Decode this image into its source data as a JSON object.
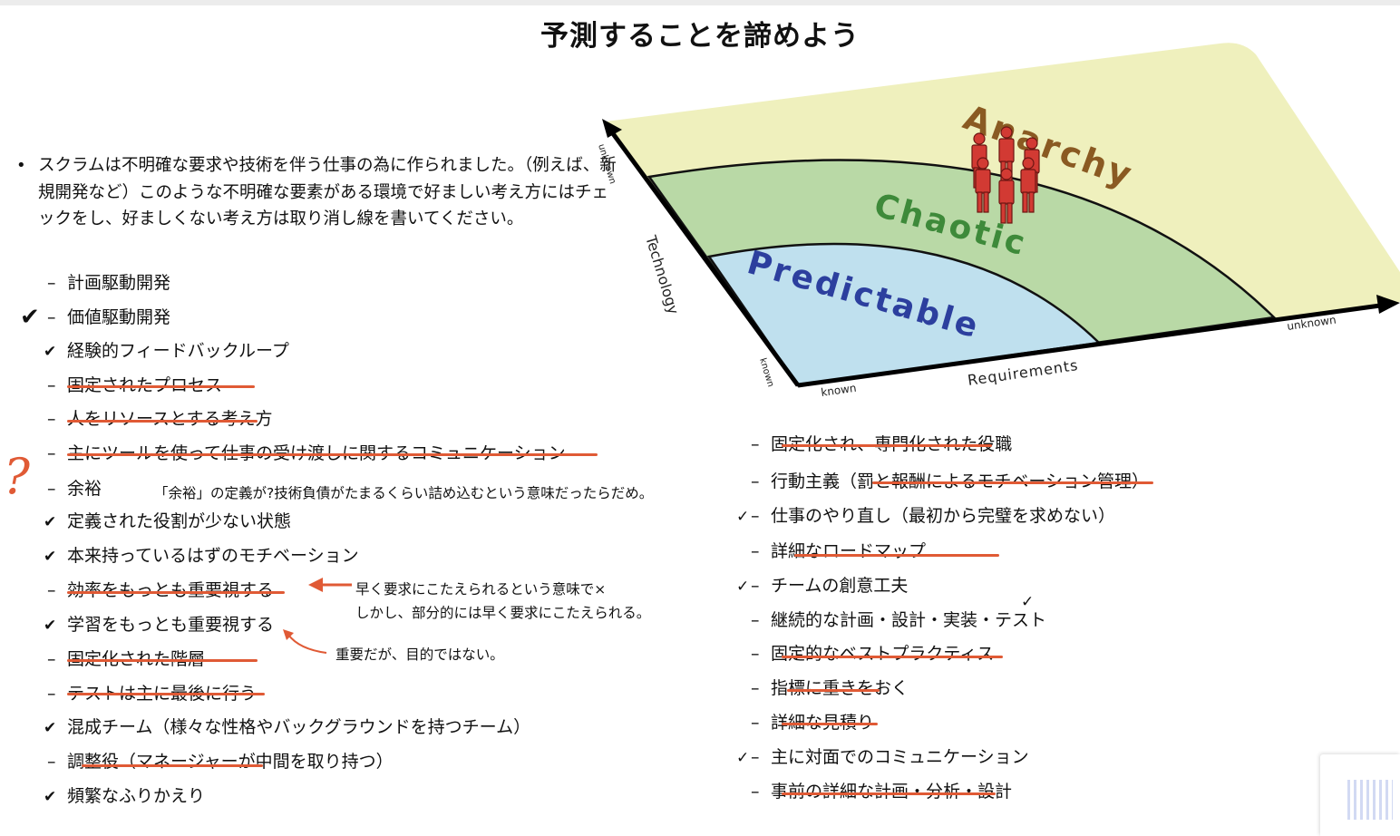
{
  "title": "予測することを諦めよう",
  "intro": "スクラムは不明確な要求や技術を伴う仕事の為に作られました。（例えば、新規開発など）このような不明確な要素がある環境で好ましい考え方にはチェックをし、好ましくない考え方は取り消し線を書いてください。",
  "bullet_symbol": "•",
  "diagram": {
    "anarchy": "Anarchy",
    "chaotic": "Chaotic",
    "predictable": "Predictable",
    "technology": "Technology",
    "requirements": "Requirements",
    "tech_unknown": "unknown",
    "tech_known": "known",
    "req_known": "known",
    "req_unknown": "unknown",
    "colors": {
      "anarchy": "#eff0bd",
      "chaotic": "#b9d9a6",
      "predictable": "#bfe0ee",
      "anarchy_text": "#8a5a22",
      "chaotic_text": "#3e8a3a",
      "predictable_text": "#2c3f9e",
      "people": "#d23a33"
    }
  },
  "left_items": [
    {
      "text": "計画駆動開発",
      "mark": ""
    },
    {
      "text": "価値駆動開発",
      "mark": "check-large"
    },
    {
      "text": "経験的フィードバックループ",
      "mark": "check"
    },
    {
      "text": "固定されたプロセス",
      "mark": "strike"
    },
    {
      "text": "人をリソースとする考え方",
      "mark": "strike"
    },
    {
      "text": "主にツールを使って仕事の受け渡しに関するコミュニケーション",
      "mark": "strike"
    },
    {
      "text": "余裕",
      "mark": "question"
    },
    {
      "text": "定義された役割が少ない状態",
      "mark": "check"
    },
    {
      "text": "本来持っているはずのモチベーション",
      "mark": "check"
    },
    {
      "text": "効率をもっとも重要視する",
      "mark": "strike"
    },
    {
      "text": "学習をもっとも重要視する",
      "mark": "check"
    },
    {
      "text": "固定化された階層",
      "mark": "strike"
    },
    {
      "text": "テストは主に最後に行う",
      "mark": "strike"
    },
    {
      "text": "混成チーム（様々な性格やバックグラウンドを持つチーム）",
      "mark": "check"
    },
    {
      "text": "調整役（マネージャーが中間を取り持つ）",
      "mark": "strike"
    },
    {
      "text": "頻繁なふりかえり",
      "mark": "check"
    }
  ],
  "right_items": [
    {
      "text": "固定化され、専門化された役職",
      "mark": "strike"
    },
    {
      "text": "行動主義（罰と報酬によるモチベーション管理）",
      "mark": "strike"
    },
    {
      "text": "仕事のやり直し（最初から完璧を求めない）",
      "mark": "check"
    },
    {
      "text": "詳細なロードマップ",
      "mark": "strike"
    },
    {
      "text": "チームの創意工夫",
      "mark": "check"
    },
    {
      "text": "継続的な計画・設計・実装・テスト",
      "mark": "check"
    },
    {
      "text": "固定的なベストプラクティス",
      "mark": "strike"
    },
    {
      "text": "指標に重きをおく",
      "mark": "strike"
    },
    {
      "text": "詳細な見積り",
      "mark": "strike"
    },
    {
      "text": "主に対面でのコミュニケーション",
      "mark": "check"
    },
    {
      "text": "事前の詳細な計画・分析・設計",
      "mark": "strike"
    }
  ],
  "notes": {
    "yoyu": "「余裕」の定義が?技術負債がたまるくらい詰め込むという意味だったらだめ。",
    "efficiency_1": "早く要求にこたえられるという意味で×",
    "efficiency_2": "しかし、部分的には早く要求にこたえられる。",
    "learning": "重要だが、目的ではない。"
  },
  "dash": "–",
  "check_glyph": "✔",
  "check_small_glyph": "✓",
  "question_glyph": "?"
}
